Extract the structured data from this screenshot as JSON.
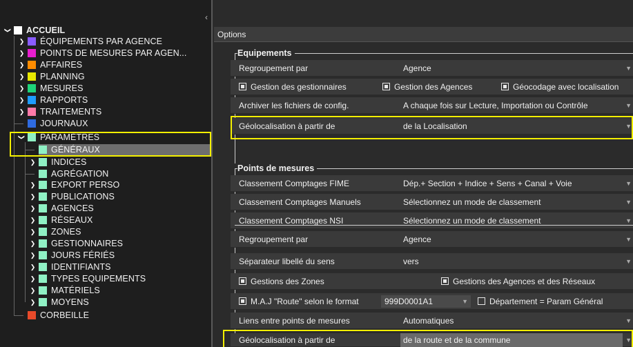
{
  "tree": {
    "items": [
      {
        "label": "ACCUEIL",
        "color": "#ffffff",
        "chev": "open",
        "bold": true
      },
      {
        "label": "ÉQUIPEMENTS PAR AGENCE",
        "color": "#8a5cff",
        "chev": "closed"
      },
      {
        "label": "POINTS DE MESURES PAR AGEN...",
        "color": "#e81ecf",
        "chev": "closed"
      },
      {
        "label": "AFFAIRES",
        "color": "#ff8c00",
        "chev": "closed"
      },
      {
        "label": "PLANNING",
        "color": "#e8e800",
        "chev": "closed"
      },
      {
        "label": "MESURES",
        "color": "#1ed47a",
        "chev": "closed"
      },
      {
        "label": "RAPPORTS",
        "color": "#1e9cff",
        "chev": "closed"
      },
      {
        "label": "TRAITEMENTS",
        "color": "#ff7aa8",
        "chev": "closed"
      },
      {
        "label": "JOURNAUX",
        "color": "#2f6be0",
        "chev": "none"
      },
      {
        "label": "PARAMÈTRES",
        "color": "#8ff0c4",
        "chev": "open"
      },
      {
        "label": "GÉNÉRAUX",
        "color": "#8ff0c4",
        "chev": "none",
        "selected": true
      },
      {
        "label": "INDICES",
        "color": "#8ff0c4",
        "chev": "closed"
      },
      {
        "label": "AGRÉGATION",
        "color": "#8ff0c4",
        "chev": "none"
      },
      {
        "label": "EXPORT PERSO",
        "color": "#8ff0c4",
        "chev": "closed"
      },
      {
        "label": "PUBLICATIONS",
        "color": "#8ff0c4",
        "chev": "closed"
      },
      {
        "label": "AGENCES",
        "color": "#8ff0c4",
        "chev": "closed"
      },
      {
        "label": "RÉSEAUX",
        "color": "#8ff0c4",
        "chev": "closed"
      },
      {
        "label": "ZONES",
        "color": "#8ff0c4",
        "chev": "closed"
      },
      {
        "label": "GESTIONNAIRES",
        "color": "#8ff0c4",
        "chev": "closed"
      },
      {
        "label": "JOURS FÉRIÉS",
        "color": "#8ff0c4",
        "chev": "closed"
      },
      {
        "label": "IDENTIFIANTS",
        "color": "#8ff0c4",
        "chev": "closed"
      },
      {
        "label": "TYPES EQUIPEMENTS",
        "color": "#8ff0c4",
        "chev": "closed"
      },
      {
        "label": "MATÉRIELS",
        "color": "#8ff0c4",
        "chev": "closed"
      },
      {
        "label": "MOYENS",
        "color": "#8ff0c4",
        "chev": "closed"
      },
      {
        "label": "CORBEILLE",
        "color": "#e84a2a",
        "chev": "none"
      }
    ]
  },
  "options": {
    "header": "Options",
    "equipements": {
      "title": "Equipements",
      "regroupement_label": "Regroupement par",
      "regroupement_value": "Agence",
      "cb_gestionnaires": "Gestion des gestionnaires",
      "cb_agences": "Gestion des Agences",
      "cb_geocodage": "Géocodage avec localisation",
      "archiver_label": "Archiver les fichiers de config.",
      "archiver_value": "A chaque fois sur Lecture, Importation ou Contrôle",
      "geoloc_label": "Géolocalisation à partir de",
      "geoloc_value": "de la Localisation"
    },
    "points": {
      "title": "Points de mesures",
      "fime_label": "Classement Comptages FIME",
      "fime_value": "Dép.+ Section + Indice + Sens + Canal + Voie",
      "manuels_label": "Classement Comptages Manuels",
      "manuels_value": "Sélectionnez un mode de classement",
      "nsi_label": "Classement Comptages NSI",
      "nsi_value": "Sélectionnez un mode de classement",
      "regroupement_label": "Regroupement par",
      "regroupement_value": "Agence",
      "separateur_label": "Séparateur libellé du sens",
      "separateur_value": "vers",
      "cb_zones": "Gestions des Zones",
      "cb_agences_reseaux": "Gestions des Agences et des Réseaux",
      "cb_maj": "M.A.J \"Route\" selon le format",
      "maj_value": "999D0001A1",
      "cb_departement": "Département = Param Général",
      "liens_label": "Liens entre points de mesures",
      "liens_value": "Automatiques",
      "geoloc_label": "Géolocalisation à partir de",
      "geoloc_value": "de la route et de la commune"
    }
  },
  "icons": {
    "collapse": "chevron-left-icon",
    "checkbox": "checkbox-checked-icon"
  },
  "colors": {
    "highlight": "#f4f000",
    "panel_bg": "#1e1e1e",
    "row_bg": "#3a3a3a"
  }
}
